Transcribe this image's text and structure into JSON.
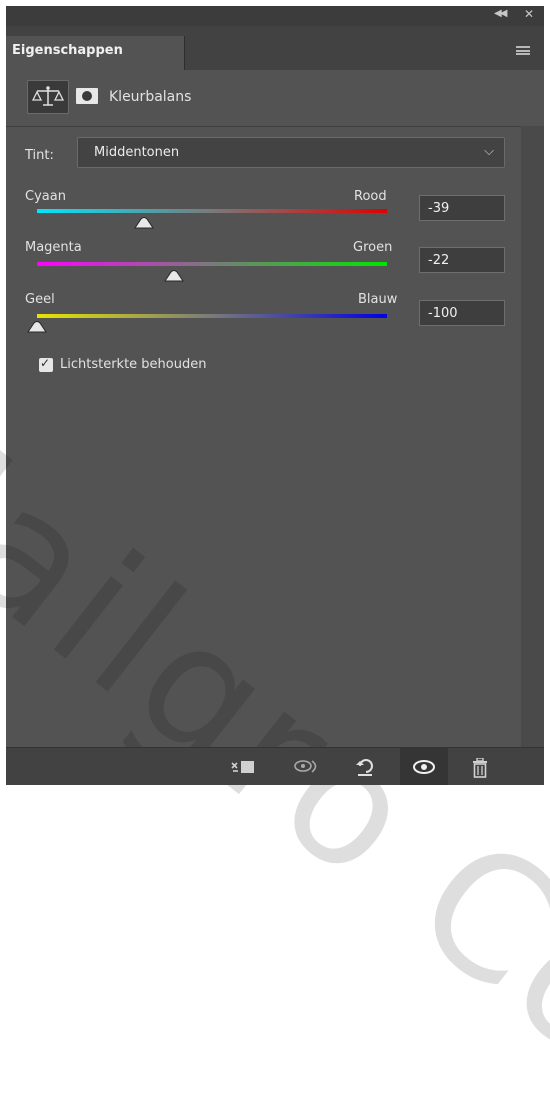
{
  "panel": {
    "tab_label": "Eigenschappen",
    "title": "Kleurbalans",
    "icons": {
      "collapse": "collapse-panel-icon",
      "close": "close-icon",
      "menu": "panel-menu-icon",
      "adjustment": "balance-scale-icon",
      "mask": "layer-mask-icon"
    }
  },
  "tint": {
    "label": "Tint:",
    "value": "Middentonen"
  },
  "sliders": [
    {
      "left": "Cyaan",
      "right": "Rood",
      "value": "-39",
      "level": -39,
      "colors": [
        "#00e6ff",
        "#e00000"
      ]
    },
    {
      "left": "Magenta",
      "right": "Groen",
      "value": "-22",
      "level": -22,
      "colors": [
        "#ff00ff",
        "#00e600"
      ]
    },
    {
      "left": "Geel",
      "right": "Blauw",
      "value": "-100",
      "level": -100,
      "colors": [
        "#e6e600",
        "#0000e6"
      ]
    }
  ],
  "preserve_luminosity": {
    "label": "Lichtsterkte behouden",
    "checked": true
  },
  "footer": {
    "icons": [
      "clip-to-layer-icon",
      "view-previous-state-icon",
      "reset-icon",
      "visibility-eye-icon",
      "trash-icon"
    ]
  },
  "watermark": "Nailgro Co"
}
